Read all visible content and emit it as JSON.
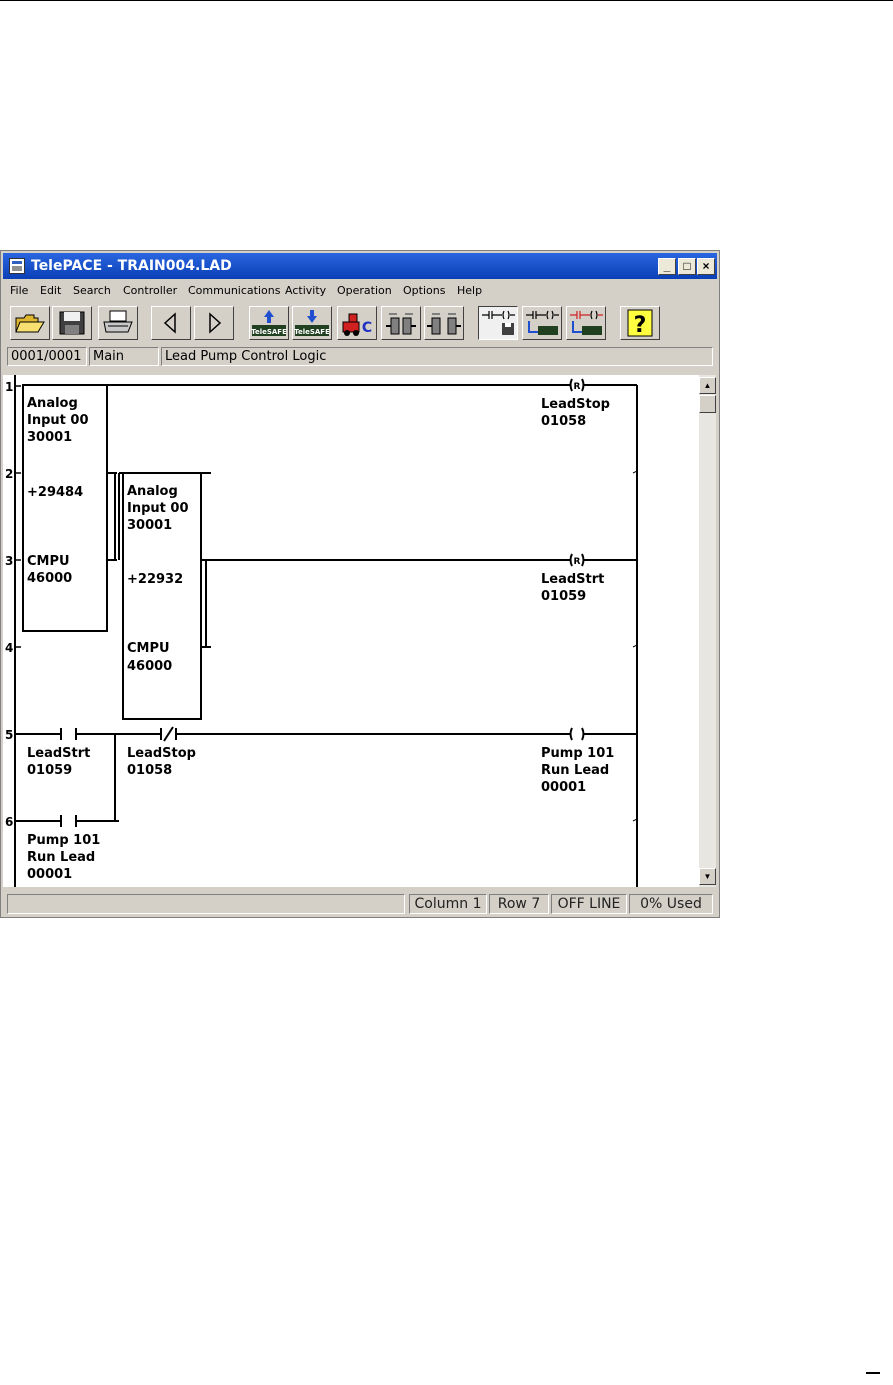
{
  "window": {
    "title": "TelePACE - TRAIN004.LAD"
  },
  "title_buttons": {
    "minimize": "_",
    "maximize": "□",
    "close": "×"
  },
  "menu": [
    "File",
    "Edit",
    "Search",
    "Controller",
    "Communications",
    "Activity",
    "Operation",
    "Options",
    "Help"
  ],
  "toolbar": {
    "telesafe_label": "TeleSAFE",
    "controller_letter": "C",
    "help_symbol": "?",
    "icons": [
      "open-folder-icon",
      "save-disk-icon",
      "print-icon",
      "back-arrow-icon",
      "forward-arrow-icon",
      "write-telesafe-icon",
      "read-telesafe-icon",
      "controller-initialize-icon",
      "connect-icon",
      "disconnect-icon",
      "ladder-save-icon",
      "ladder-write-icon",
      "ladder-read-icon",
      "help-icon"
    ]
  },
  "info_bar": {
    "position": "0001/0001",
    "network": "Main",
    "description": "Lead Pump Control Logic"
  },
  "ladder": {
    "rung_numbers": [
      "1",
      "2",
      "3",
      "4",
      "5",
      "6"
    ],
    "block1": {
      "input_label": "Analog",
      "input_label2": "Input 00",
      "input_reg": "30001",
      "value": "+29484",
      "func": "CMPU",
      "func_reg": "46000"
    },
    "block2": {
      "input_label": "Analog",
      "input_label2": "Input 00",
      "input_reg": "30001",
      "value": "+22932",
      "func": "CMPU",
      "func_reg": "46000"
    },
    "coil1": {
      "symbol": "(R)",
      "label": "LeadStop",
      "reg": "01058"
    },
    "coil2": {
      "symbol": "(R)",
      "label": "LeadStrt",
      "reg": "01059"
    },
    "coil3": {
      "symbol": "( )",
      "label1": "Pump 101",
      "label2": "Run Lead",
      "reg": "00001"
    },
    "contact1": {
      "label": "LeadStrt",
      "reg": "01059"
    },
    "contact2": {
      "label": "LeadStop",
      "reg": "01058"
    },
    "contact3": {
      "label1": "Pump 101",
      "label2": "Run Lead",
      "reg": "00001"
    }
  },
  "scrollbar": {
    "up": "▲",
    "down": "▼"
  },
  "status": {
    "message": "",
    "column": "Column 1",
    "row": "Row 7",
    "mode": "OFF LINE",
    "used": "0% Used"
  }
}
